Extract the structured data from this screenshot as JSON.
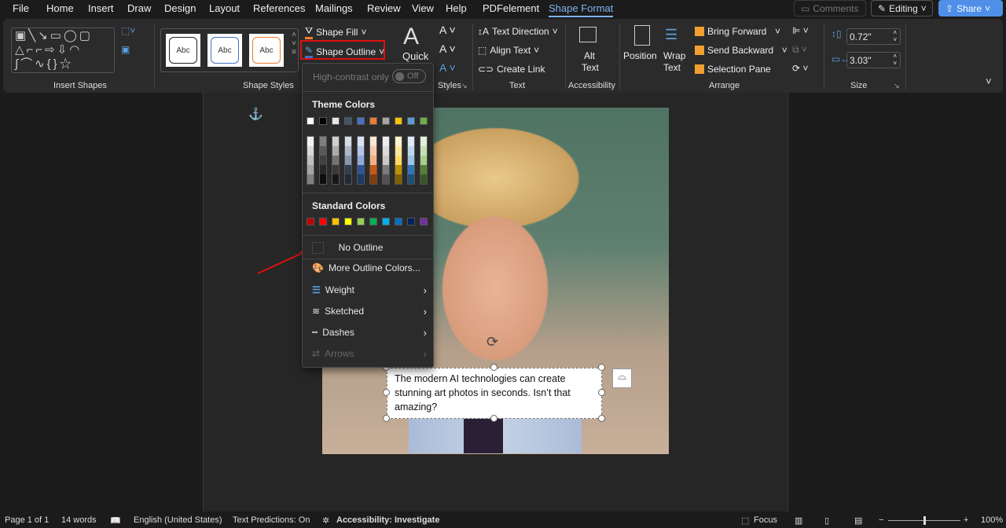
{
  "menu": {
    "tabs": [
      "File",
      "Home",
      "Insert",
      "Draw",
      "Design",
      "Layout",
      "References",
      "Mailings",
      "Review",
      "View",
      "Help",
      "PDFelement",
      "Shape Format"
    ],
    "comments": "Comments",
    "editing": "Editing",
    "share": "Share"
  },
  "ribbon": {
    "insert_shapes": "Insert Shapes",
    "styles": [
      "Abc",
      "Abc",
      "Abc"
    ],
    "style_colors": [
      "#222222",
      "#4472c4",
      "#ed7d31"
    ],
    "shape_styles": "Shape Styles",
    "shape_fill": "Shape Fill",
    "shape_outline": "Shape Outline",
    "quick": "Quick",
    "wordart_styles": "Styles",
    "text_direction": "Text Direction",
    "align_text": "Align Text",
    "create_link": "Create Link",
    "text_group": "Text",
    "alt_text_1": "Alt",
    "alt_text_2": "Text",
    "accessibility": "Accessibility",
    "position": "Position",
    "wrap_1": "Wrap",
    "wrap_2": "Text",
    "bring_forward": "Bring Forward",
    "send_backward": "Send Backward",
    "selection_pane": "Selection Pane",
    "arrange": "Arrange",
    "height": "0.72\"",
    "width": "3.03\"",
    "size": "Size"
  },
  "dropdown": {
    "high_contrast": "High-contrast only",
    "toggle": "Off",
    "theme_colors": "Theme Colors",
    "theme_top": [
      "#ffffff",
      "#000000",
      "#e7e6e6",
      "#44546a",
      "#4472c4",
      "#ed7d31",
      "#a5a5a5",
      "#ffc000",
      "#5b9bd5",
      "#70ad47"
    ],
    "theme_shades": [
      [
        "#f2f2f2",
        "#d9d9d9",
        "#bfbfbf",
        "#a6a6a6",
        "#808080"
      ],
      [
        "#7f7f7f",
        "#595959",
        "#404040",
        "#262626",
        "#0d0d0d"
      ],
      [
        "#d0cece",
        "#aeabab",
        "#757171",
        "#3a3838",
        "#171616"
      ],
      [
        "#d6dce4",
        "#acb9ca",
        "#8497b0",
        "#333f4f",
        "#222a35"
      ],
      [
        "#d9e2f3",
        "#b4c6e7",
        "#8eaadb",
        "#2f5496",
        "#1f3864"
      ],
      [
        "#fbe5d5",
        "#f7caac",
        "#f4b083",
        "#c55a11",
        "#833c0b"
      ],
      [
        "#ededed",
        "#dbdbdb",
        "#c9c9c9",
        "#7b7b7b",
        "#525252"
      ],
      [
        "#fff2cc",
        "#fee599",
        "#ffd965",
        "#bf9000",
        "#7f6000"
      ],
      [
        "#deeaf6",
        "#bdd7ee",
        "#9cc3e5",
        "#2e75b5",
        "#1f4e79"
      ],
      [
        "#e2efd9",
        "#c5e0b3",
        "#a8d08d",
        "#538135",
        "#375623"
      ]
    ],
    "standard_colors_label": "Standard Colors",
    "standard_colors": [
      "#c00000",
      "#ff0000",
      "#ffc000",
      "#ffff00",
      "#92d050",
      "#00b050",
      "#00b0f0",
      "#0070c0",
      "#002060",
      "#7030a0"
    ],
    "no_outline": "No Outline",
    "more_colors": "More Outline Colors...",
    "weight": "Weight",
    "sketched": "Sketched",
    "dashes": "Dashes",
    "arrows": "Arrows"
  },
  "document": {
    "textbox": "The modern AI technologies can create stunning art photos in seconds. Isn’t that amazing?"
  },
  "status": {
    "page": "Page 1 of 1",
    "words": "14 words",
    "language": "English (United States)",
    "predictions": "Text Predictions: On",
    "accessibility": "Accessibility: Investigate",
    "focus": "Focus",
    "zoom": "100%"
  }
}
